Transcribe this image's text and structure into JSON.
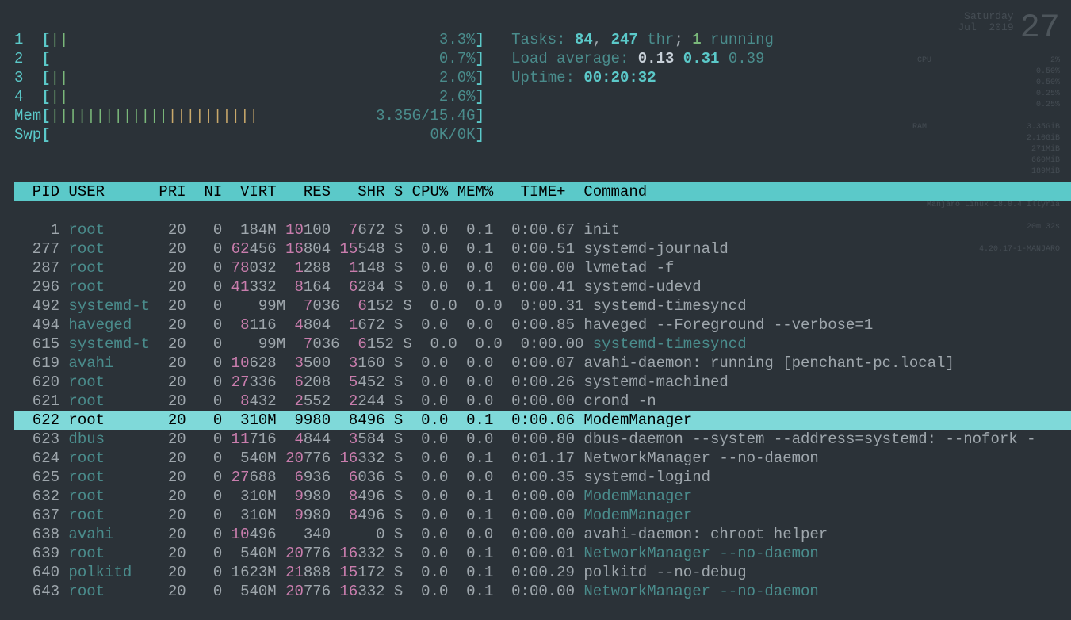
{
  "cpu_meters": [
    {
      "id": "1",
      "bars": "||",
      "pct": "3.3%"
    },
    {
      "id": "2",
      "bars": "",
      "pct": "0.7%"
    },
    {
      "id": "3",
      "bars": "||",
      "pct": "2.0%"
    },
    {
      "id": "4",
      "bars": "||",
      "pct": "2.6%"
    }
  ],
  "mem": {
    "label": "Mem",
    "bars_g": "|||||||||||||",
    "bars_y": "||||||||||",
    "value": "3.35G/15.4G"
  },
  "swp": {
    "label": "Swp",
    "value": "0K/0K"
  },
  "stats": {
    "tasks_label": "Tasks: ",
    "tasks": "84",
    "tasks_sep": ", ",
    "threads": "247",
    "thr_label": " thr",
    "run_sep": "; ",
    "running": "1",
    "running_label": " running",
    "load_label": "Load average: ",
    "l1": "0.13",
    "l5": "0.31",
    "l15": "0.39",
    "uptime_label": "Uptime: ",
    "uptime": "00:20:32"
  },
  "header": "  PID USER      PRI  NI  VIRT   RES   SHR S CPU% MEM%   TIME+  Command",
  "rows": [
    {
      "pid": "    1",
      "user": "root     ",
      "pri": " 20",
      "ni": "  0",
      "virt_c": " ",
      "virt": "184M",
      "res_c": "10",
      "res": "100",
      "shr_c": " 7",
      "shr": "672",
      "s": "S",
      "cpu": " 0.0",
      "mem": " 0.1",
      "time": " 0:00.67",
      "cmd": "init",
      "child": false,
      "sel": false
    },
    {
      "pid": "  277",
      "user": "root     ",
      "pri": " 20",
      "ni": "  0",
      "virt_c": "62",
      "virt": "456",
      "res_c": "16",
      "res": "804",
      "shr_c": "15",
      "shr": "548",
      "s": "S",
      "cpu": " 0.0",
      "mem": " 0.1",
      "time": " 0:00.51",
      "cmd": "systemd-journald",
      "child": false,
      "sel": false
    },
    {
      "pid": "  287",
      "user": "root     ",
      "pri": " 20",
      "ni": "  0",
      "virt_c": "78",
      "virt": "032",
      "res_c": " 1",
      "res": "288",
      "shr_c": " 1",
      "shr": "148",
      "s": "S",
      "cpu": " 0.0",
      "mem": " 0.0",
      "time": " 0:00.00",
      "cmd": "lvmetad -f",
      "child": false,
      "sel": false
    },
    {
      "pid": "  296",
      "user": "root     ",
      "pri": " 20",
      "ni": "  0",
      "virt_c": "41",
      "virt": "332",
      "res_c": " 8",
      "res": "164",
      "shr_c": " 6",
      "shr": "284",
      "s": "S",
      "cpu": " 0.0",
      "mem": " 0.1",
      "time": " 0:00.41",
      "cmd": "systemd-udevd",
      "child": false,
      "sel": false
    },
    {
      "pid": "  492",
      "user": "systemd-t",
      "pri": " 20",
      "ni": "  0",
      "virt_c": "  ",
      "virt": " 99M",
      "res_c": " 7",
      "res": "036",
      "shr_c": " 6",
      "shr": "152",
      "s": "S",
      "cpu": " 0.0",
      "mem": " 0.0",
      "time": " 0:00.31",
      "cmd": "systemd-timesyncd",
      "child": false,
      "sel": false
    },
    {
      "pid": "  494",
      "user": "haveged  ",
      "pri": " 20",
      "ni": "  0",
      "virt_c": " 8",
      "virt": "116",
      "res_c": " 4",
      "res": "804",
      "shr_c": " 1",
      "shr": "672",
      "s": "S",
      "cpu": " 0.0",
      "mem": " 0.0",
      "time": " 0:00.85",
      "cmd": "haveged --Foreground --verbose=1",
      "child": false,
      "sel": false
    },
    {
      "pid": "  615",
      "user": "systemd-t",
      "pri": " 20",
      "ni": "  0",
      "virt_c": "  ",
      "virt": " 99M",
      "res_c": " 7",
      "res": "036",
      "shr_c": " 6",
      "shr": "152",
      "s": "S",
      "cpu": " 0.0",
      "mem": " 0.0",
      "time": " 0:00.00",
      "cmd": "systemd-timesyncd",
      "child": true,
      "sel": false
    },
    {
      "pid": "  619",
      "user": "avahi    ",
      "pri": " 20",
      "ni": "  0",
      "virt_c": "10",
      "virt": "628",
      "res_c": " 3",
      "res": "500",
      "shr_c": " 3",
      "shr": "160",
      "s": "S",
      "cpu": " 0.0",
      "mem": " 0.0",
      "time": " 0:00.07",
      "cmd": "avahi-daemon: running [penchant-pc.local]",
      "child": false,
      "sel": false
    },
    {
      "pid": "  620",
      "user": "root     ",
      "pri": " 20",
      "ni": "  0",
      "virt_c": "27",
      "virt": "336",
      "res_c": " 6",
      "res": "208",
      "shr_c": " 5",
      "shr": "452",
      "s": "S",
      "cpu": " 0.0",
      "mem": " 0.0",
      "time": " 0:00.26",
      "cmd": "systemd-machined",
      "child": false,
      "sel": false
    },
    {
      "pid": "  621",
      "user": "root     ",
      "pri": " 20",
      "ni": "  0",
      "virt_c": " 8",
      "virt": "432",
      "res_c": " 2",
      "res": "552",
      "shr_c": " 2",
      "shr": "244",
      "s": "S",
      "cpu": " 0.0",
      "mem": " 0.0",
      "time": " 0:00.00",
      "cmd": "crond -n",
      "child": false,
      "sel": false
    },
    {
      "pid": "  622",
      "user": "root     ",
      "pri": " 20",
      "ni": "  0",
      "virt_c": " ",
      "virt": "310M",
      "res_c": " 9",
      "res": "980",
      "shr_c": " 8",
      "shr": "496",
      "s": "S",
      "cpu": " 0.0",
      "mem": " 0.1",
      "time": " 0:00.06",
      "cmd": "ModemManager",
      "child": false,
      "sel": true
    },
    {
      "pid": "  623",
      "user": "dbus     ",
      "pri": " 20",
      "ni": "  0",
      "virt_c": "11",
      "virt": "716",
      "res_c": " 4",
      "res": "844",
      "shr_c": " 3",
      "shr": "584",
      "s": "S",
      "cpu": " 0.0",
      "mem": " 0.0",
      "time": " 0:00.80",
      "cmd": "dbus-daemon --system --address=systemd: --nofork -",
      "child": false,
      "sel": false
    },
    {
      "pid": "  624",
      "user": "root     ",
      "pri": " 20",
      "ni": "  0",
      "virt_c": " ",
      "virt": "540M",
      "res_c": "20",
      "res": "776",
      "shr_c": "16",
      "shr": "332",
      "s": "S",
      "cpu": " 0.0",
      "mem": " 0.1",
      "time": " 0:01.17",
      "cmd": "NetworkManager --no-daemon",
      "child": false,
      "sel": false
    },
    {
      "pid": "  625",
      "user": "root     ",
      "pri": " 20",
      "ni": "  0",
      "virt_c": "27",
      "virt": "688",
      "res_c": " 6",
      "res": "936",
      "shr_c": " 6",
      "shr": "036",
      "s": "S",
      "cpu": " 0.0",
      "mem": " 0.0",
      "time": " 0:00.35",
      "cmd": "systemd-logind",
      "child": false,
      "sel": false
    },
    {
      "pid": "  632",
      "user": "root     ",
      "pri": " 20",
      "ni": "  0",
      "virt_c": " ",
      "virt": "310M",
      "res_c": " 9",
      "res": "980",
      "shr_c": " 8",
      "shr": "496",
      "s": "S",
      "cpu": " 0.0",
      "mem": " 0.1",
      "time": " 0:00.00",
      "cmd": "ModemManager",
      "child": true,
      "sel": false
    },
    {
      "pid": "  637",
      "user": "root     ",
      "pri": " 20",
      "ni": "  0",
      "virt_c": " ",
      "virt": "310M",
      "res_c": " 9",
      "res": "980",
      "shr_c": " 8",
      "shr": "496",
      "s": "S",
      "cpu": " 0.0",
      "mem": " 0.1",
      "time": " 0:00.00",
      "cmd": "ModemManager",
      "child": true,
      "sel": false
    },
    {
      "pid": "  638",
      "user": "avahi    ",
      "pri": " 20",
      "ni": "  0",
      "virt_c": "10",
      "virt": "496",
      "res_c": "  ",
      "res": "340",
      "shr_c": "  ",
      "shr": "  0",
      "s": "S",
      "cpu": " 0.0",
      "mem": " 0.0",
      "time": " 0:00.00",
      "cmd": "avahi-daemon: chroot helper",
      "child": false,
      "sel": false
    },
    {
      "pid": "  639",
      "user": "root     ",
      "pri": " 20",
      "ni": "  0",
      "virt_c": " ",
      "virt": "540M",
      "res_c": "20",
      "res": "776",
      "shr_c": "16",
      "shr": "332",
      "s": "S",
      "cpu": " 0.0",
      "mem": " 0.1",
      "time": " 0:00.01",
      "cmd": "NetworkManager --no-daemon",
      "child": true,
      "sel": false
    },
    {
      "pid": "  640",
      "user": "polkitd  ",
      "pri": " 20",
      "ni": "  0",
      "virt_c": "",
      "virt": "1623M",
      "res_c": "21",
      "res": "888",
      "shr_c": "15",
      "shr": "172",
      "s": "S",
      "cpu": " 0.0",
      "mem": " 0.1",
      "time": " 0:00.29",
      "cmd": "polkitd --no-debug",
      "child": false,
      "sel": false
    },
    {
      "pid": "  643",
      "user": "root     ",
      "pri": " 20",
      "ni": "  0",
      "virt_c": " ",
      "virt": "540M",
      "res_c": "20",
      "res": "776",
      "shr_c": "16",
      "shr": "332",
      "s": "S",
      "cpu": " 0.0",
      "mem": " 0.1",
      "time": " 0:00.00",
      "cmd": "NetworkManager --no-daemon",
      "child": true,
      "sel": false
    }
  ],
  "conky": {
    "day": "Saturday",
    "daynum": "27",
    "month": "Jul",
    "year": "2019",
    "cpu_lbl": "CPU",
    "cpu_pct": "2%",
    "cores": [
      "0.50%",
      "0.50%",
      "0.25%",
      "0.25%"
    ],
    "ram_lbl": "RAM",
    "ram_val": "3.35GiB",
    "vals": [
      "2.10GiB",
      "271MiB",
      "660MiB",
      "189MiB"
    ],
    "distro": "Manjaro Linux 18.0.4 Illyria",
    "uptime": "20m 32s",
    "kernel": "4.20.17-1-MANJARO"
  }
}
